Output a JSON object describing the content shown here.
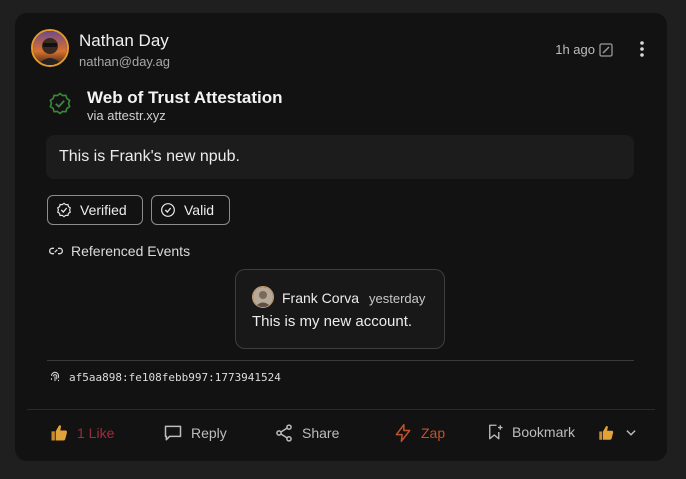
{
  "post": {
    "author": {
      "name": "Nathan Day",
      "nip05": "nathan@day.ag"
    },
    "time": "1h ago",
    "attestation": {
      "title": "Web of Trust Attestation",
      "via": "via attestr.xyz"
    },
    "content": "This is Frank's new npub.",
    "badges": {
      "verified": "Verified",
      "valid": "Valid"
    },
    "referenced": {
      "title": "Referenced Events",
      "event": {
        "name": "Frank Corva",
        "time": "yesterday",
        "content": "This is my new account."
      }
    },
    "fingerprint": "af5aa898:fe108febb997:1773941524"
  },
  "actions": {
    "like": "1 Like",
    "reply": "Reply",
    "share": "Share",
    "zap": "Zap",
    "bookmark": "Bookmark"
  },
  "colors": {
    "like": "#9a2f3e",
    "zap": "#c0532e",
    "verified_icon": "#3b8a3b"
  }
}
